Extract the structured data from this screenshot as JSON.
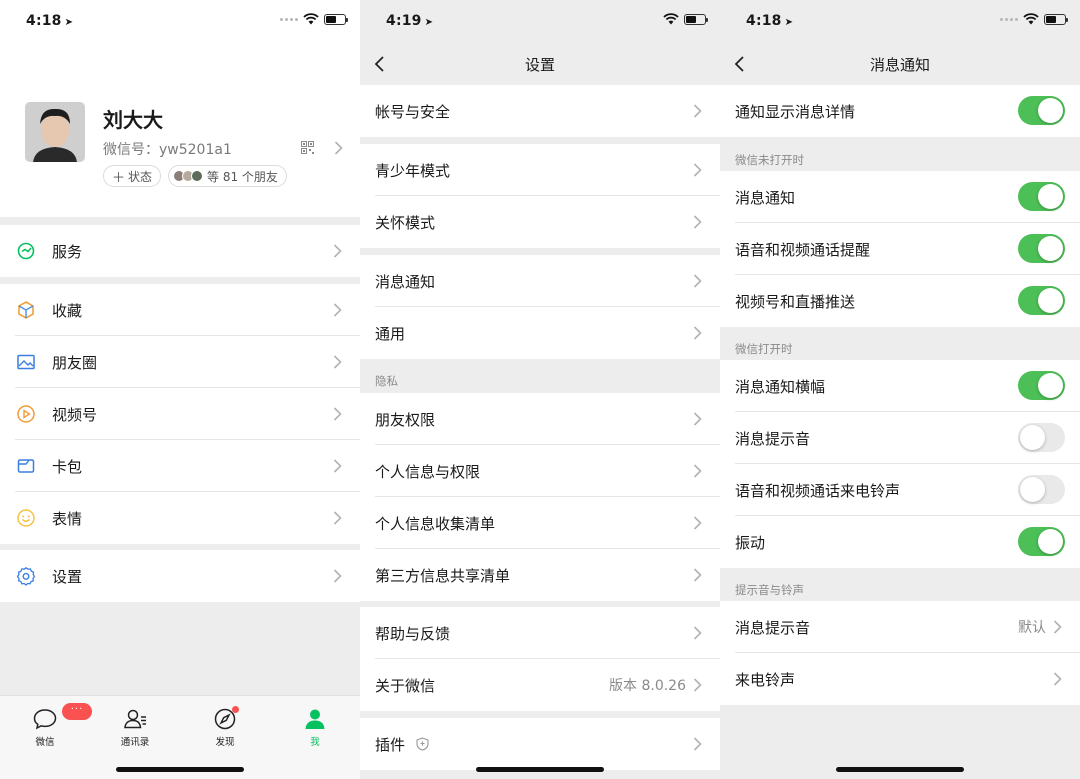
{
  "colors": {
    "accent": "#07c160",
    "toggle_on": "#4cbf56",
    "badge": "#fa5151"
  },
  "screen1": {
    "status": {
      "time": "4:18"
    },
    "profile": {
      "name": "刘大大",
      "wechat_id": "微信号：yw5201a1",
      "status_chip": "状态",
      "friends_chip": "等 81 个朋友"
    },
    "menu": [
      {
        "label": "服务",
        "icon": "service-icon"
      },
      {
        "label": "收藏",
        "icon": "favorites-icon"
      },
      {
        "label": "朋友圈",
        "icon": "moments-icon"
      },
      {
        "label": "视频号",
        "icon": "channels-icon"
      },
      {
        "label": "卡包",
        "icon": "cards-icon"
      },
      {
        "label": "表情",
        "icon": "sticker-icon"
      },
      {
        "label": "设置",
        "icon": "settings-icon"
      }
    ],
    "tabs": [
      {
        "label": "微信",
        "badge": "···"
      },
      {
        "label": "通讯录"
      },
      {
        "label": "发现"
      },
      {
        "label": "我"
      }
    ]
  },
  "screen2": {
    "status": {
      "time": "4:19"
    },
    "title": "设置",
    "rows": [
      {
        "label": "帐号与安全"
      },
      {
        "label": "青少年模式"
      },
      {
        "label": "关怀模式"
      },
      {
        "label": "消息通知"
      },
      {
        "label": "通用"
      },
      {
        "label": "朋友权限"
      },
      {
        "label": "个人信息与权限"
      },
      {
        "label": "个人信息收集清单"
      },
      {
        "label": "第三方信息共享清单"
      },
      {
        "label": "帮助与反馈"
      },
      {
        "label": "关于微信",
        "value": "版本 8.0.26"
      },
      {
        "label": "插件"
      }
    ],
    "sections": {
      "privacy": "隐私"
    }
  },
  "screen3": {
    "status": {
      "time": "4:18"
    },
    "title": "消息通知",
    "sections": {
      "closed": "微信未打开时",
      "open": "微信打开时",
      "sounds": "提示音与铃声"
    },
    "rows": [
      {
        "label": "通知显示消息详情",
        "on": true
      },
      {
        "label": "消息通知",
        "on": true
      },
      {
        "label": "语音和视频通话提醒",
        "on": true
      },
      {
        "label": "视频号和直播推送",
        "on": true
      },
      {
        "label": "消息通知横幅",
        "on": true
      },
      {
        "label": "消息提示音",
        "on": false
      },
      {
        "label": "语音和视频通话来电铃声",
        "on": false
      },
      {
        "label": "振动",
        "on": true
      },
      {
        "label": "消息提示音",
        "value": "默认"
      },
      {
        "label": "来电铃声"
      }
    ]
  }
}
